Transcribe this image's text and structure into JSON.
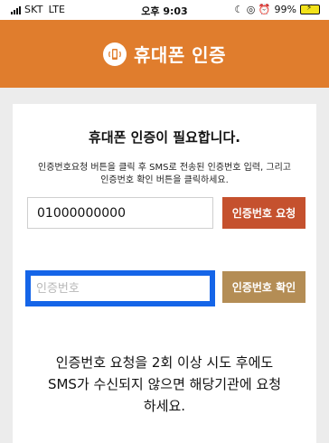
{
  "status_bar": {
    "carrier": "SKT",
    "network": "LTE",
    "time": "오후 9:03",
    "indicators": "☾ ◎ ⏰",
    "battery": "99%",
    "battery_color": "#f2e21a"
  },
  "header": {
    "title": "휴대폰 인증",
    "icon": "phone-vibrate-icon",
    "background": "#e07d2d"
  },
  "main": {
    "title": "휴대폰 인증이 필요합니다.",
    "description_line1": "인증번호요청 버튼을 클릭 후 SMS로 전송된 인증번호 입력, 그리고",
    "description_line2": "인증번호 확인 버튼을 클릭하세요.",
    "phone_input_value": "01000000000",
    "code_input_placeholder": "인증번호",
    "request_button_label": "인증번호 요청",
    "confirm_button_label": "인증번호 확인",
    "notice_line1": "인증번호 요청을 2회 이상 시도 후에도",
    "notice_line2": "SMS가 수신되지 않으면 해당기관에 요청",
    "notice_line3": "하세요."
  },
  "colors": {
    "request_button": "#c5512e",
    "confirm_button": "#b48d55",
    "focus_border": "#1565e8"
  }
}
